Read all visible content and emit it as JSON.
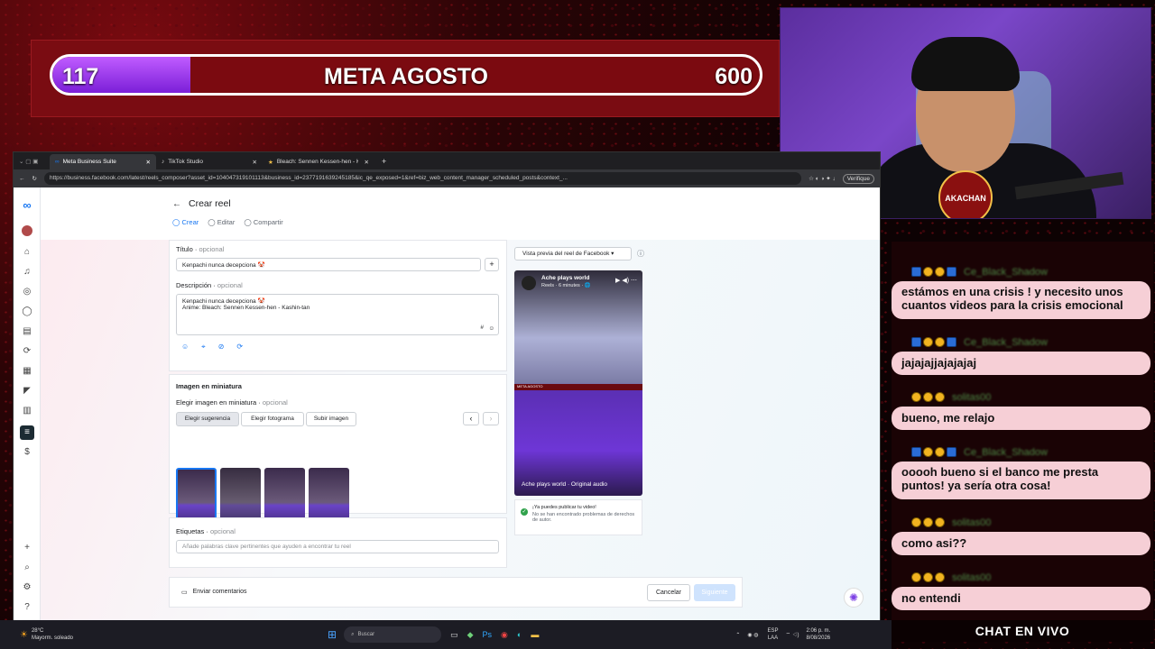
{
  "goal": {
    "current": "117",
    "title": "META AGOSTO",
    "target": "600",
    "progress_fraction": 0.195
  },
  "browser": {
    "tabs": [
      {
        "label": "Meta Business Suite",
        "active": true
      },
      {
        "label": "TikTok Studio",
        "active": false
      },
      {
        "label": "Bleach: Sennen Kessen-hen - Kashi",
        "active": false
      }
    ],
    "url": "https://business.facebook.com/latest/reels_composer?asset_id=104047319101113&business_id=2377191639245185&ic_qe_exposed=1&ref=biz_web_content_manager_scheduled_posts&context_...",
    "update_label": "Verifique"
  },
  "page": {
    "title": "Crear reel",
    "steps": [
      "Crear",
      "Editar",
      "Compartir"
    ],
    "titulo_label": "Título",
    "optional": "opcional",
    "titulo_value": "Kenpachi nunca decepciona 🤡",
    "descripcion_label": "Descripción",
    "descripcion_line1": "Kenpachi nunca decepciona 🤡",
    "descripcion_line2": "Anime: Bleach: Sennen Kessen-hen - Kashin-tan",
    "hash": "#",
    "thumb_section": "Imagen en miniatura",
    "thumb_choose": "Elegir imagen en miniatura",
    "thumb_tabs": [
      "Elegir sugerencia",
      "Elegir fotograma",
      "Subir imagen"
    ],
    "tags_label": "Etiquetas",
    "tags_placeholder": "Añade palabras clave pertinentes que ayuden a encontrar tu reel",
    "preview_dropdown": "Vista previa del reel de Facebook",
    "preview_account": "Ache plays world",
    "preview_meta": "Reels · 6 minutes · 🌐",
    "preview_overlay": "META AGOSTO",
    "preview_audio": "Ache plays world · Original audio",
    "publish_ok": "¡Ya puedes publicar tu video!",
    "publish_note": "No se han encontrado problemas de derechos de autor.",
    "feedback": "Enviar comentarios",
    "cancel": "Cancelar",
    "next": "Siguiente"
  },
  "chat": {
    "title": "CHAT EN VIVO",
    "messages": [
      {
        "text": "estámos en una crisis ! y necesito unos cuantos videos para la crisis emocional",
        "user": "Ce_Black_Shadow"
      },
      {
        "text": "jajajajjajajajaj",
        "user": "Ce_Black_Shadow"
      },
      {
        "text": "bueno, me relajo",
        "user": "solitas00"
      },
      {
        "text": "ooooh bueno si el banco me presta puntos! ya sería otra cosa!",
        "user": "Ce_Black_Shadow"
      },
      {
        "text": "como asi??",
        "user": "solitas00"
      },
      {
        "text": "no entendi",
        "user": "solitas00"
      }
    ]
  },
  "cam": {
    "logo": "AKACHAN"
  },
  "taskbar": {
    "weather_temp": "28°C",
    "weather_desc": "Mayorm. soleado",
    "search": "Buscar",
    "lang": "ESP",
    "region": "LAA",
    "time": "2:06 p. m.",
    "date": "8/08/2026"
  },
  "colors": {
    "goal_fill": "#8b2be2",
    "banner_red": "#7a0c12",
    "chat_bubble": "#f6cfd6",
    "fb_blue": "#1877f2"
  }
}
